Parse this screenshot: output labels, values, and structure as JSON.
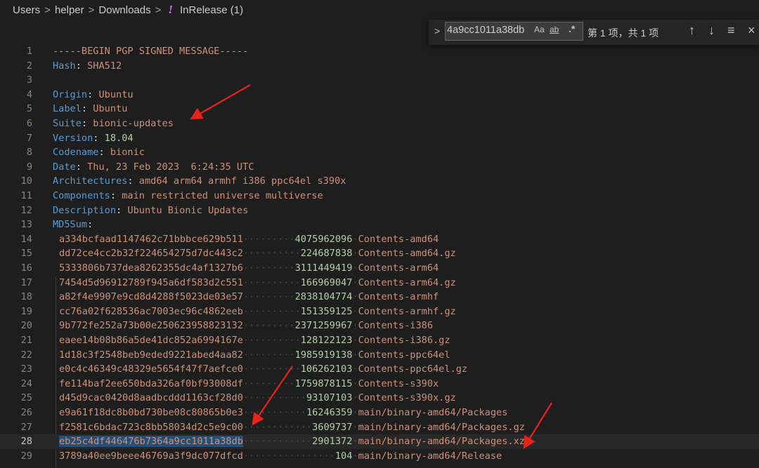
{
  "breadcrumb": {
    "items": [
      "Users",
      "helper",
      "Downloads"
    ],
    "separator": ">",
    "warn_glyph": "!",
    "file": "InRelease (1)"
  },
  "find": {
    "toggle_glyph": ">",
    "query": "4a9cc1011a38db",
    "match_case": "Aa",
    "whole_word": "ab",
    "regex": ".*",
    "result": "第 1 项，共 1 项",
    "prev_icon": "↑",
    "next_icon": "↓",
    "selection_icon": "≡",
    "close_icon": "×"
  },
  "editor": {
    "current_line": 28,
    "header_lines": [
      {
        "n": "1",
        "rule": "-----BEGIN PGP SIGNED MESSAGE-----"
      },
      {
        "n": "2",
        "key": "Hash",
        "value": "SHA512"
      },
      {
        "n": "3"
      },
      {
        "n": "4",
        "key": "Origin",
        "value": "Ubuntu"
      },
      {
        "n": "5",
        "key": "Label",
        "value": "Ubuntu"
      },
      {
        "n": "6",
        "key": "Suite",
        "value": "bionic-updates"
      },
      {
        "n": "7",
        "key": "Version",
        "num": "18.04"
      },
      {
        "n": "8",
        "key": "Codename",
        "value": "bionic"
      },
      {
        "n": "9",
        "key": "Date",
        "value": "Thu, 23 Feb 2023  6:24:35 UTC"
      },
      {
        "n": "10",
        "key": "Architectures",
        "value": "amd64 arm64 armhf i386 ppc64el s390x"
      },
      {
        "n": "11",
        "key": "Components",
        "value": "main restricted universe multiverse"
      },
      {
        "n": "12",
        "key": "Description",
        "value": "Ubuntu Bionic Updates"
      },
      {
        "n": "13",
        "key": "MD5Sum",
        "value": ""
      }
    ],
    "checksum_lines": [
      {
        "n": "14",
        "hash": "a334bcfaad1147462c71bbbce629b511",
        "size": "4075962096",
        "name": "Contents-amd64"
      },
      {
        "n": "15",
        "hash": "dd72ce4cc2b32f224654275d7dc443c2",
        "size": "224687838",
        "name": "Contents-amd64.gz"
      },
      {
        "n": "16",
        "hash": "5333806b737dea8262355dc4af1327b6",
        "size": "3111449419",
        "name": "Contents-arm64"
      },
      {
        "n": "17",
        "hash": "7454d5d96912789f945a6df583d2c551",
        "size": "166969047",
        "name": "Contents-arm64.gz"
      },
      {
        "n": "18",
        "hash": "a82f4e9907e9cd8d4288f5023de03e57",
        "size": "2838104774",
        "name": "Contents-armhf"
      },
      {
        "n": "19",
        "hash": "cc76a02f628536ac7003ec96c4862eeb",
        "size": "151359125",
        "name": "Contents-armhf.gz"
      },
      {
        "n": "20",
        "hash": "9b772fe252a73b00e250623958823132",
        "size": "2371259967",
        "name": "Contents-i386"
      },
      {
        "n": "21",
        "hash": "eaee14b08b86a5de41dc852a6994167e",
        "size": "128122123",
        "name": "Contents-i386.gz"
      },
      {
        "n": "22",
        "hash": "1d18c3f2548beb9eded9221abed4aa82",
        "size": "1985919138",
        "name": "Contents-ppc64el"
      },
      {
        "n": "23",
        "hash": "e0c4c46349c48329e5654f47f7aefce0",
        "size": "106262103",
        "name": "Contents-ppc64el.gz"
      },
      {
        "n": "24",
        "hash": "fe114baf2ee650bda326af0bf93008df",
        "size": "1759878115",
        "name": "Contents-s390x"
      },
      {
        "n": "25",
        "hash": "d45d9cac0420d8aadbcddd1163cf28d0",
        "size": "93107103",
        "name": "Contents-s390x.gz"
      },
      {
        "n": "26",
        "hash": "e9a61f18dc8b0bd730be08c80865b0e3",
        "size": "16246359",
        "name": "main/binary-amd64/Packages"
      },
      {
        "n": "27",
        "hash": "f2581c6bdac723c8bb58034d2c5e9c00",
        "size": "3609737",
        "name": "main/binary-amd64/Packages.gz"
      },
      {
        "n": "28",
        "hash": "eb25c4df446476b7364a9cc1011a38db",
        "size": "2901372",
        "name": "main/binary-amd64/Packages.xz"
      },
      {
        "n": "29",
        "hash": "3789a40ee9beee46769a3f9dc077dfcd",
        "size": "104",
        "name": "main/binary-amd64/Release"
      }
    ]
  },
  "colors": {
    "background": "#1e1e1e",
    "key": "#569cd6",
    "string": "#ce9178",
    "number": "#b5cea8",
    "selection": "#264f78",
    "find_border": "#007fd4",
    "annotation_arrow": "#e8231c"
  },
  "annotations": [
    "red-arrow-suite",
    "red-arrow-hash-line-28",
    "red-arrow-packages-xz"
  ]
}
